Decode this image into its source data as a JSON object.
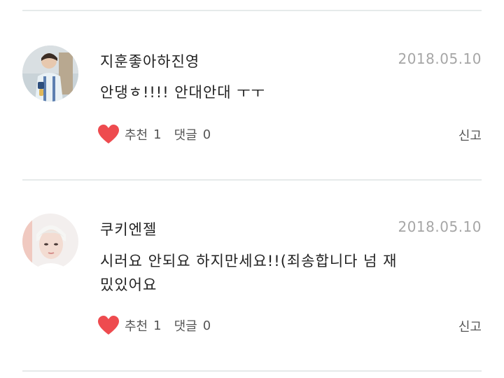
{
  "comments": [
    {
      "username": "지훈좋아하진영",
      "date": "2018.05.10",
      "text": "안댕ㅎ!!!! 안대안대 ㅜㅜ",
      "like_label": "추천",
      "like_count": "1",
      "reply_label": "댓글",
      "reply_count": "0",
      "report_label": "신고",
      "avatar": "profile-photo"
    },
    {
      "username": "쿠키엔젤",
      "date": "2018.05.10",
      "text": "시러요 안되요 하지만세요!!(죄송합니다 넘 재밌있어요",
      "like_label": "추천",
      "like_count": "1",
      "reply_label": "댓글",
      "reply_count": "0",
      "report_label": "신고",
      "avatar": "profile-photo"
    }
  ],
  "colors": {
    "heart": "#ee4b4f",
    "divider": "#e6eaea",
    "date": "#a6a6a6"
  }
}
